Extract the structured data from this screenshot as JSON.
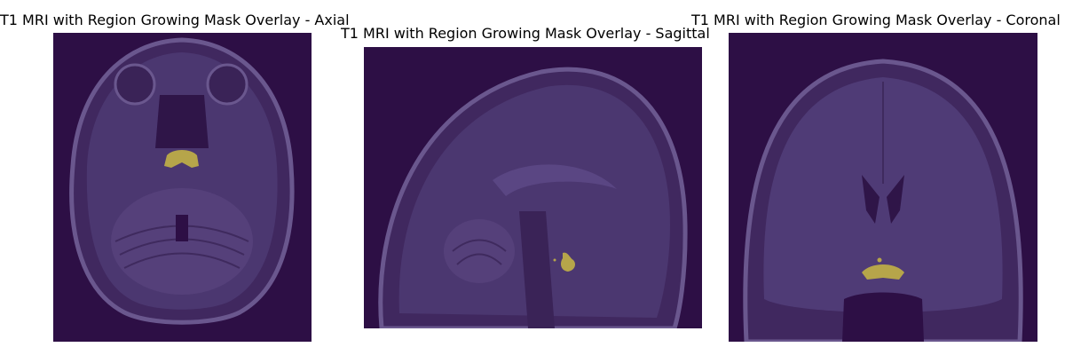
{
  "panels": [
    {
      "title": "T1 MRI with Region Growing Mask Overlay - Axial",
      "view": "axial",
      "colors": {
        "background": "#2d0f45",
        "tissue": "#4b3770",
        "mask": "#b6a54a"
      }
    },
    {
      "title": "T1 MRI with Region Growing Mask Overlay - Sagittal",
      "view": "sagittal",
      "colors": {
        "background": "#2d0f45",
        "tissue": "#4b3770",
        "mask": "#b6a54a"
      }
    },
    {
      "title": "T1 MRI with Region Growing Mask Overlay - Coronal",
      "view": "coronal",
      "colors": {
        "background": "#2d0f45",
        "tissue": "#4b3770",
        "mask": "#b6a54a"
      }
    }
  ]
}
